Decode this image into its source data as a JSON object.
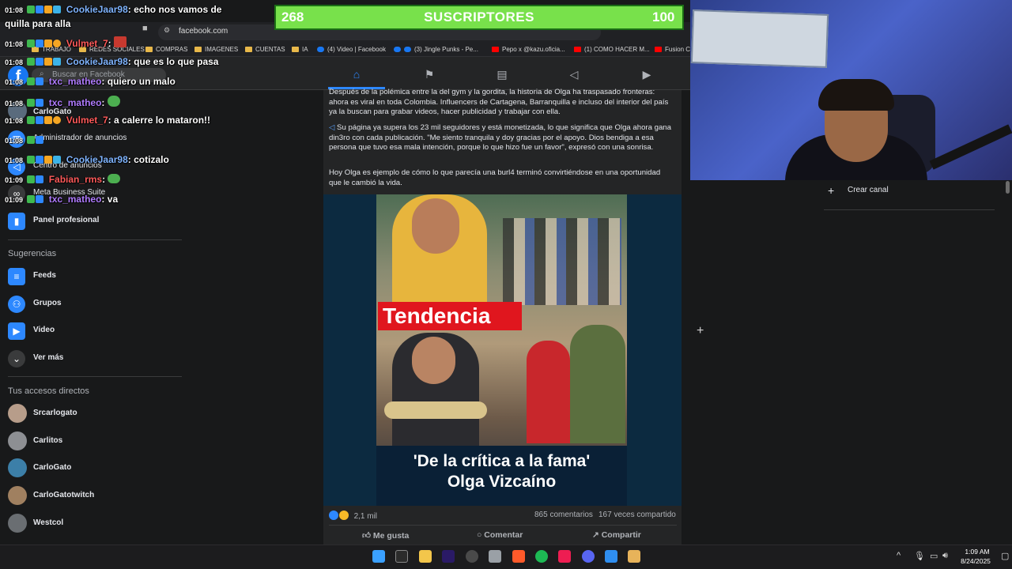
{
  "browser": {
    "url": "facebook.com",
    "bookmarks": [
      "TRABAJO",
      "REDES SOCIALES",
      "COMPRAS",
      "IMAGENES",
      "CUENTAS",
      "IA",
      "(4) Video | Facebook",
      "(3) Jingle Punks - Pe...",
      "Pepo x @kazu.oficia...",
      "(1) COMO HACER M...",
      "Fusion Cl"
    ]
  },
  "fb": {
    "logo": "f",
    "search_placeholder": "Buscar en Facebook"
  },
  "sidebar": {
    "items": [
      {
        "label": "CarloGato"
      },
      {
        "label": "Administrador de anuncios"
      },
      {
        "label": "Centro de anuncios"
      },
      {
        "label": "Meta Business Suite"
      },
      {
        "label": "Panel profesional"
      }
    ],
    "suggestions_heading": "Sugerencias",
    "suggestions": [
      {
        "label": "Feeds"
      },
      {
        "label": "Grupos"
      },
      {
        "label": "Video"
      },
      {
        "label": "Ver más"
      }
    ],
    "shortcuts_heading": "Tus accesos directos",
    "shortcuts": [
      {
        "label": "Srcarlogato"
      },
      {
        "label": "Carlitos"
      },
      {
        "label": "CarloGato"
      },
      {
        "label": "CarloGatotwitch"
      },
      {
        "label": "Westcol"
      }
    ]
  },
  "chat": [
    {
      "time": "01:08",
      "user": "CookieJaar98",
      "msg": "echo nos vamos de",
      "color": "#7fb4ff"
    },
    {
      "time": "",
      "user": "",
      "msg": "quilla para alla",
      "color": "#7fb4ff"
    },
    {
      "time": "01:08",
      "user": "Vulmet_7",
      "msg": "",
      "color": "#ff5a5a"
    },
    {
      "time": "01:08",
      "user": "CookieJaar98",
      "msg": "que es lo que pasa",
      "color": "#7fb4ff"
    },
    {
      "time": "01:08",
      "user": "txc_matheo",
      "msg": "quiero un malo",
      "color": "#b07cff"
    },
    {
      "time": "01:08",
      "user": "txc_matheo",
      "msg": "",
      "color": "#b07cff"
    },
    {
      "time": "01:08",
      "user": "Vulmet_7",
      "msg": "a calerre lo mataron!!",
      "color": "#ff5a5a"
    },
    {
      "time": "01:08",
      "user": "",
      "msg": "",
      "color": "#ff5a5a"
    },
    {
      "time": "01:08",
      "user": "CookieJaar98",
      "msg": "cotizalo",
      "color": "#7fb4ff"
    },
    {
      "time": "01:09",
      "user": "Fabian_rms",
      "msg": "",
      "color": "#ff5a5a"
    },
    {
      "time": "01:09",
      "user": "txc_matheo",
      "msg": "va",
      "color": "#b07cff"
    }
  ],
  "post": {
    "paragraph_1": "Después de la polémica entre la del gym y la gordita, la historia de Olga ha traspasado fronteras: ahora es viral en toda Colombia. Influencers de Cartagena, Barranquilla e incluso del interior del país ya la buscan para grabar videos, hacer publicidad y trabajar con ella.",
    "paragraph_2": "Su página ya supera los 23 mil seguidores y está monetizada, lo que significa que Olga ahora gana din3ro con cada publicación. \"Me siento tranquila y doy gracias por el apoyo. Dios bendiga a esa persona que tuvo esa mala intención, porque lo que hizo fue un favor\", expresó con una sonrisa.",
    "paragraph_3": "Hoy Olga es ejemplo de cómo lo que parecía una burl4 terminó convirtiéndose en una oportunidad que le cambió la vida.",
    "image_badge": "Tendencia",
    "image_caption_1": "'De la crítica a la fama'",
    "image_caption_2": "Olga Vizcaíno",
    "reactions": "2,1 mil",
    "comments": "865 comentarios",
    "shares": "167 veces compartido",
    "actions": {
      "like": "Me gusta",
      "comment": "Comentar",
      "share": "Compartir"
    }
  },
  "right": {
    "create_channel": "Crear canal"
  },
  "sub_goal": {
    "current": "268",
    "label": "SUSCRIPTORES",
    "goal": "100"
  },
  "taskbar": {
    "time": "1:09 AM",
    "date": "8/24/2025"
  },
  "colors": {
    "fb_blue": "#1877f2",
    "sub_banner": "#78e14b",
    "tendencia_red": "#e0161e"
  }
}
